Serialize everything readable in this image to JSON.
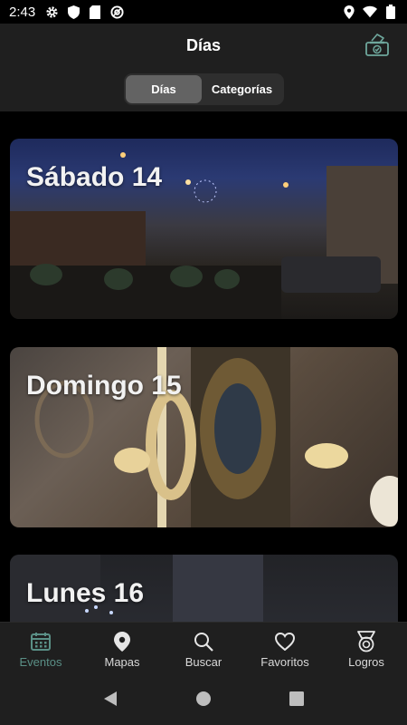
{
  "status_bar": {
    "time": "2:43",
    "left_icons": [
      "gear-icon",
      "shield-icon",
      "sd-card-icon",
      "at-sign-icon"
    ],
    "right_icons": [
      "location-icon",
      "wifi-icon",
      "battery-icon"
    ]
  },
  "app_bar": {
    "title": "Días",
    "action_icon": "ballot-box-icon"
  },
  "segmented": {
    "options": [
      "Días",
      "Categorías"
    ],
    "selected": "Días"
  },
  "cards": [
    {
      "title": "Sábado 14"
    },
    {
      "title": "Domingo 15"
    },
    {
      "title": "Lunes 16"
    }
  ],
  "bottom_nav": {
    "items": [
      {
        "label": "Eventos",
        "icon": "calendar-icon",
        "active": true
      },
      {
        "label": "Mapas",
        "icon": "map-pin-icon",
        "active": false
      },
      {
        "label": "Buscar",
        "icon": "search-icon",
        "active": false
      },
      {
        "label": "Favoritos",
        "icon": "heart-icon",
        "active": false
      },
      {
        "label": "Logros",
        "icon": "medal-icon",
        "active": false
      }
    ]
  },
  "colors": {
    "accent": "#5a8f86",
    "app_bar_bg": "#1f1f1f",
    "segment_active_bg": "#636363",
    "background": "#000000"
  }
}
